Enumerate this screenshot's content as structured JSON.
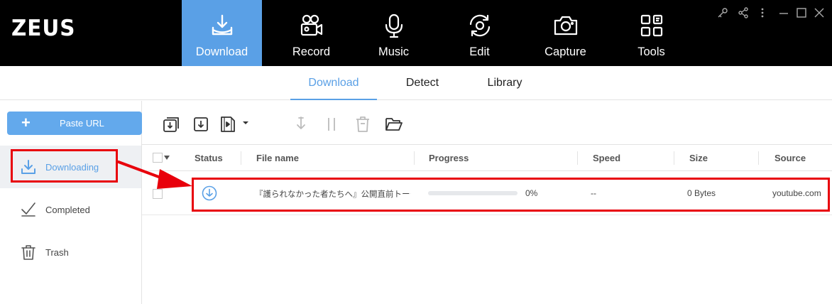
{
  "app": {
    "logo": "ZEUS"
  },
  "nav": [
    {
      "label": "Download",
      "icon": "download-tray-icon",
      "active": true
    },
    {
      "label": "Record",
      "icon": "video-camera-icon",
      "active": false
    },
    {
      "label": "Music",
      "icon": "microphone-icon",
      "active": false
    },
    {
      "label": "Edit",
      "icon": "refresh-edit-icon",
      "active": false
    },
    {
      "label": "Capture",
      "icon": "camera-icon",
      "active": false
    },
    {
      "label": "Tools",
      "icon": "tools-grid-icon",
      "active": false
    }
  ],
  "window_controls": [
    "key-icon",
    "share-icon",
    "more-icon",
    "minimize-icon",
    "maximize-icon",
    "close-icon"
  ],
  "subtabs": [
    {
      "label": "Download",
      "active": true
    },
    {
      "label": "Detect",
      "active": false
    },
    {
      "label": "Library",
      "active": false
    }
  ],
  "sidebar": {
    "paste_url": "Paste URL",
    "items": [
      {
        "label": "Downloading",
        "icon": "download-icon",
        "active": true
      },
      {
        "label": "Completed",
        "icon": "checkmark-icon",
        "active": false
      },
      {
        "label": "Trash",
        "icon": "trash-icon",
        "active": false
      }
    ]
  },
  "table": {
    "columns": [
      "Status",
      "File name",
      "Progress",
      "Speed",
      "Size",
      "Source"
    ],
    "rows": [
      {
        "status_icon": "downloading-status-icon",
        "file_name": "『護られなかった者たちへ』公開直前トークイ...",
        "progress": 0,
        "progress_label": "0%",
        "speed": "--",
        "size": "0 Bytes",
        "source": "youtube.com"
      }
    ]
  },
  "colors": {
    "accent": "#5aa0e6",
    "topbar": "#000000",
    "annotation": "#e8000b"
  }
}
